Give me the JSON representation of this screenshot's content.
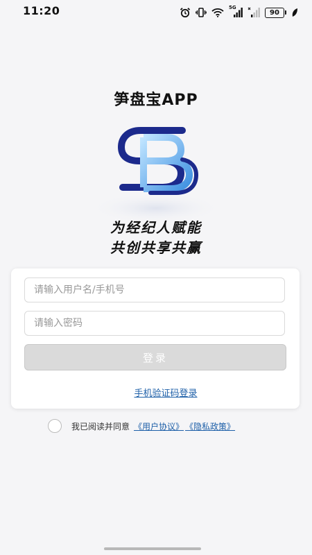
{
  "status_bar": {
    "time": "11:20",
    "battery": "90",
    "network_label": "5G",
    "icons": [
      "alarm-icon",
      "vibrate-icon",
      "wifi-icon",
      "signal-icon",
      "signal-weak-icon",
      "battery-icon",
      "leaf-icon"
    ]
  },
  "app": {
    "title": "笋盘宝APP",
    "logo_icon": "sb-logo-icon",
    "slogan_line1": "为经纪人赋能",
    "slogan_line2": "共创共享共赢"
  },
  "login_form": {
    "username_placeholder": "请输入用户名/手机号",
    "username_value": "",
    "password_placeholder": "请输入密码",
    "password_value": "",
    "login_label": "登录",
    "sms_login_label": "手机验证码登录"
  },
  "agreement": {
    "checked": false,
    "text": "我已阅读并同意",
    "user_agreement": "《用户协议》",
    "privacy_policy": "《隐私政策》"
  },
  "colors": {
    "background": "#f5f5f7",
    "card": "#ffffff",
    "link": "#1d5fa8",
    "button_disabled": "#dadada",
    "logo_dark": "#1c2a8c",
    "logo_light": "#4fa8e8"
  }
}
